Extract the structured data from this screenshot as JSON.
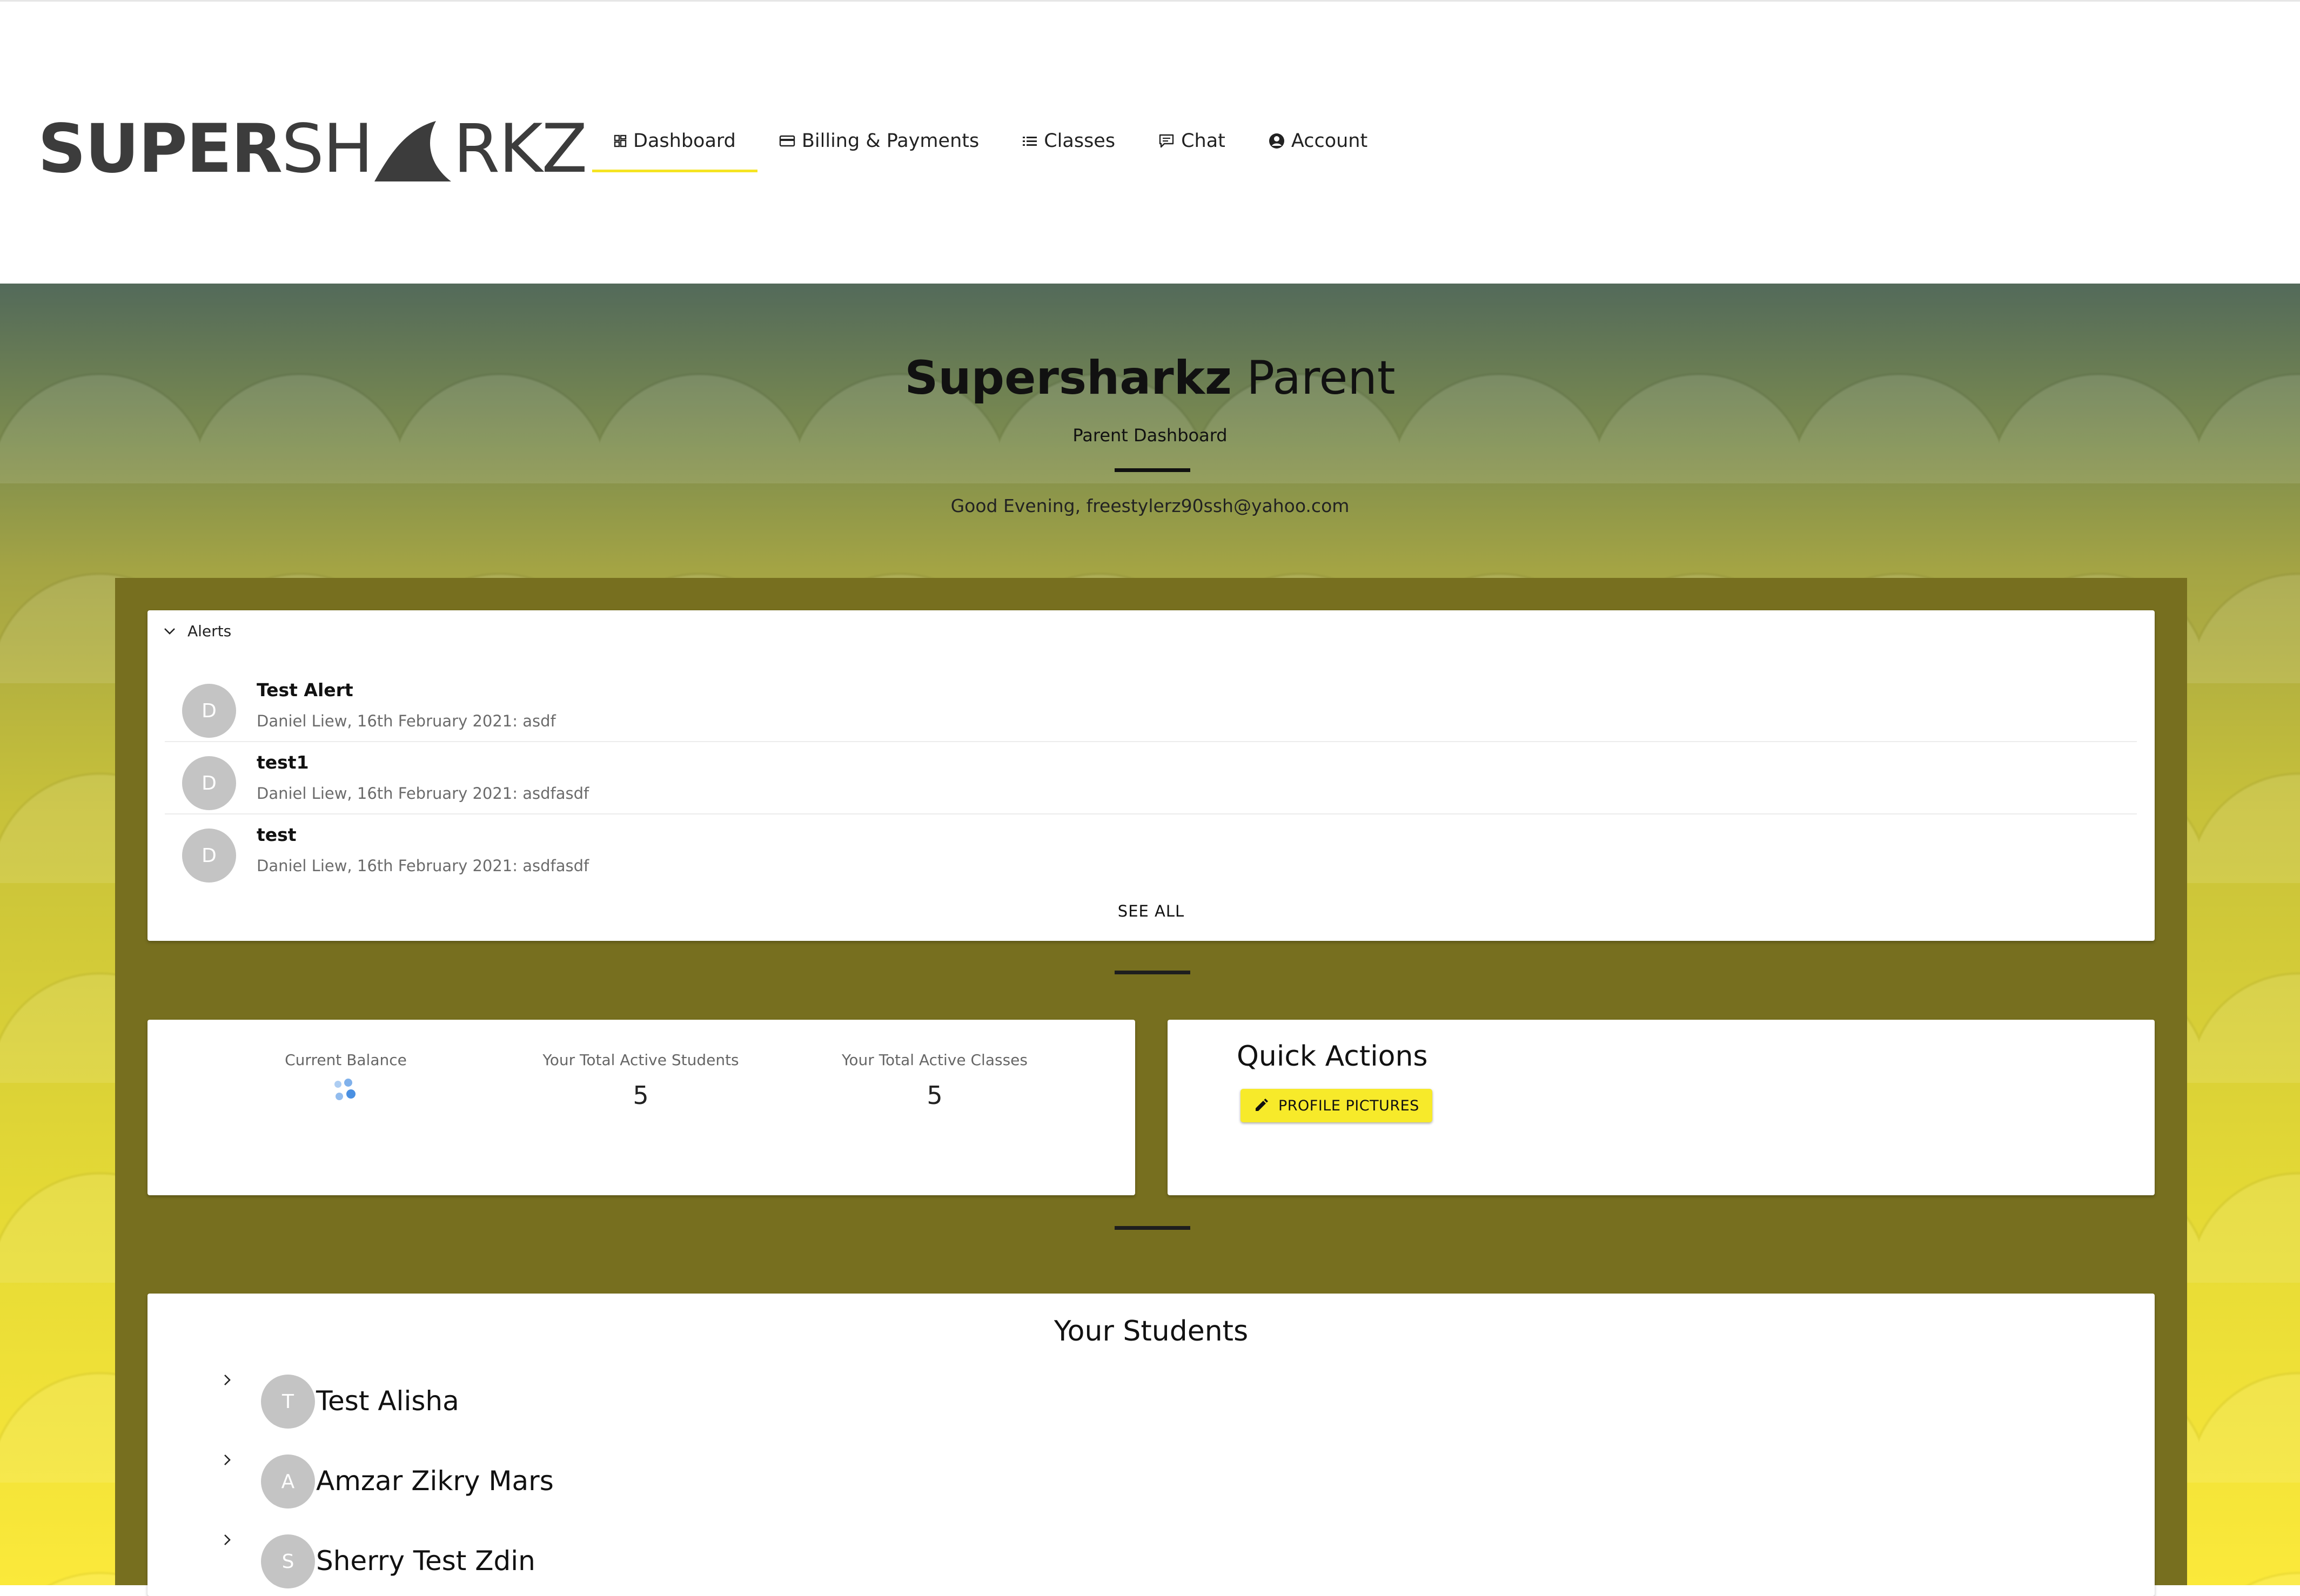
{
  "brand": {
    "logo_bold": "SUPER",
    "logo_light_1": "SH",
    "logo_light_2": "RKZ",
    "accent": "#f5e423"
  },
  "nav": {
    "items": [
      {
        "label": "Dashboard",
        "icon": "dashboard-icon",
        "active": true
      },
      {
        "label": "Billing & Payments",
        "icon": "credit-card-icon",
        "active": false
      },
      {
        "label": "Classes",
        "icon": "list-icon",
        "active": false
      },
      {
        "label": "Chat",
        "icon": "chat-icon",
        "active": false
      },
      {
        "label": "Account",
        "icon": "account-circle-icon",
        "active": false
      }
    ]
  },
  "hero": {
    "title_bold": "Supersharkz",
    "title_light": " Parent",
    "subtitle": "Parent Dashboard",
    "greeting": "Good Evening, freestylerz90ssh@yahoo.com"
  },
  "alerts": {
    "header": "Alerts",
    "items": [
      {
        "avatar": "D",
        "title": "Test Alert",
        "meta": "Daniel Liew, 16th February 2021: asdf"
      },
      {
        "avatar": "D",
        "title": "test1",
        "meta": "Daniel Liew, 16th February 2021: asdfasdf"
      },
      {
        "avatar": "D",
        "title": "test",
        "meta": "Daniel Liew, 16th February 2021: asdfasdf"
      }
    ],
    "see_all": "SEE ALL"
  },
  "stats": {
    "balance_label": "Current Balance",
    "students_label": "Your Total Active Students",
    "students_value": "5",
    "classes_label": "Your Total Active Classes",
    "classes_value": "5"
  },
  "quick_actions": {
    "title": "Quick Actions",
    "button_label": "PROFILE PICTURES",
    "button_color": "#f7ea2a"
  },
  "students": {
    "title": "Your Students",
    "items": [
      {
        "avatar": "T",
        "name": "Test Alisha"
      },
      {
        "avatar": "A",
        "name": "Amzar Zikry Mars"
      },
      {
        "avatar": "S",
        "name": "Sherry Test Zdin"
      }
    ]
  }
}
